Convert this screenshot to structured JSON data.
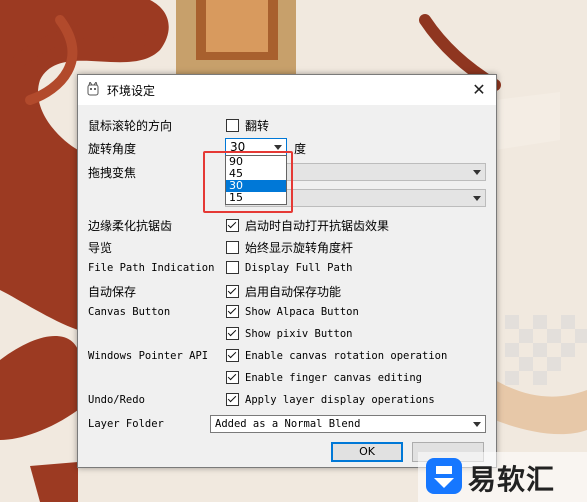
{
  "window": {
    "title": "环境设定"
  },
  "rows": {
    "scroll_direction": {
      "label": "鼠标滚轮的方向",
      "option": "翻转",
      "checked": false
    },
    "rotation_angle": {
      "label": "旋转角度",
      "value": "30",
      "unit": "度",
      "options": [
        "90",
        "45",
        "30",
        "15"
      ],
      "selected": "30"
    },
    "drag_transform": {
      "label": "拖拽变焦"
    },
    "edge_soften": {
      "label": "边缘柔化抗锯齿",
      "option": "启动时自动打开抗锯齿效果",
      "checked": true
    },
    "guide": {
      "label": "导览",
      "option": "始终显示旋转角度杆",
      "checked": false
    },
    "file_path": {
      "label": "File Path Indication",
      "option": "Display Full Path",
      "checked": false
    },
    "autosave": {
      "label": "自动保存",
      "option": "启用自动保存功能",
      "checked": true
    },
    "canvas_button": {
      "label": "Canvas Button",
      "options": [
        {
          "text": "Show Alpaca Button",
          "checked": true
        },
        {
          "text": "Show pixiv Button",
          "checked": true
        }
      ]
    },
    "pointer_api": {
      "label": "Windows Pointer API",
      "options": [
        {
          "text": "Enable canvas rotation operation",
          "checked": true
        },
        {
          "text": "Enable finger canvas editing",
          "checked": true
        }
      ]
    },
    "undo_redo": {
      "label": "Undo/Redo",
      "option": "Apply layer display operations",
      "checked": true
    },
    "layer_folder": {
      "label": "Layer Folder",
      "value": "Added as a Normal Blend"
    }
  },
  "buttons": {
    "ok": "OK",
    "cancel": ""
  },
  "watermark": {
    "text": "易软汇"
  },
  "colors": {
    "accent": "#0078d7",
    "highlight_box": "#e53935",
    "art_brown": "#9c3a22"
  }
}
